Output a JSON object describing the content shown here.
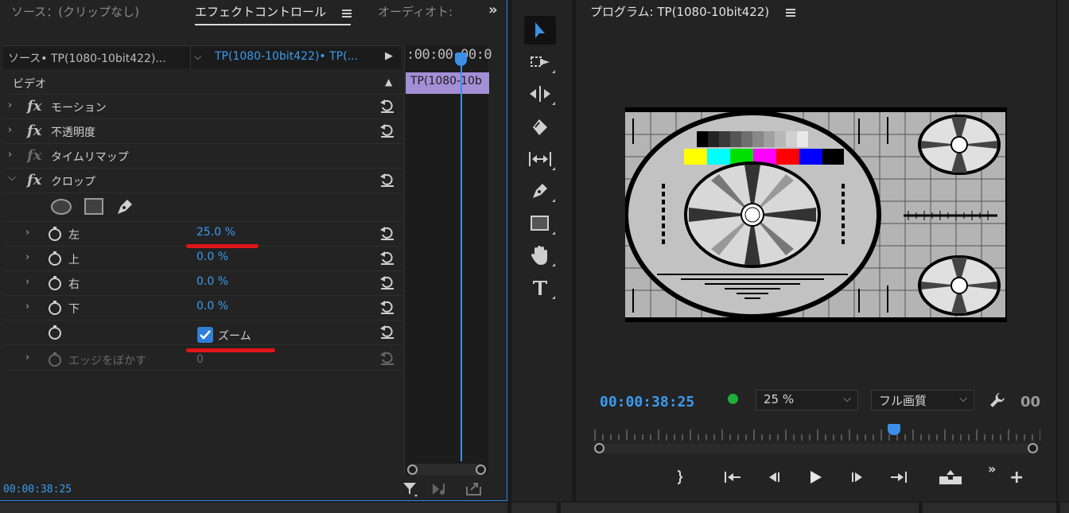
{
  "effect_controls": {
    "tabs": [
      "ソース：(クリップなし)",
      "エフェクトコントロール",
      "オーディオト:"
    ],
    "source_label": "ソース• TP(1080-10bit422)...",
    "sequence_label": "TP(1080-10bit422)• TP(...",
    "section_label": "ビデオ",
    "effects": {
      "motion": "モーション",
      "opacity": "不透明度",
      "time_remap": "タイムリマップ",
      "crop": "クロップ"
    },
    "crop_params": {
      "left_label": "左",
      "left_value": "25.0",
      "top_label": "上",
      "top_value": "0.0",
      "right_label": "右",
      "right_value": "0.0",
      "bottom_label": "下",
      "bottom_value": "0.0",
      "unit": "%",
      "zoom_label": "ズーム",
      "zoom_checked": true,
      "feather_label": "エッジをぼかす",
      "feather_value": "0"
    },
    "timeline": {
      "timecode": ":00:00 00:0",
      "clip_label": "TP(1080-10b"
    },
    "current_time": "00:00:38:25"
  },
  "program_monitor": {
    "title": "プログラム: TP(1080-10bit422)",
    "timecode": "00:00:38:25",
    "zoom": "25 %",
    "quality": "フル画質",
    "extra": "00"
  },
  "colors": {
    "accent_blue": "#3b9cf0",
    "clip_purple": "#a38fd6",
    "annotation_red": "#e0151a",
    "status_green": "#1fae3a"
  }
}
